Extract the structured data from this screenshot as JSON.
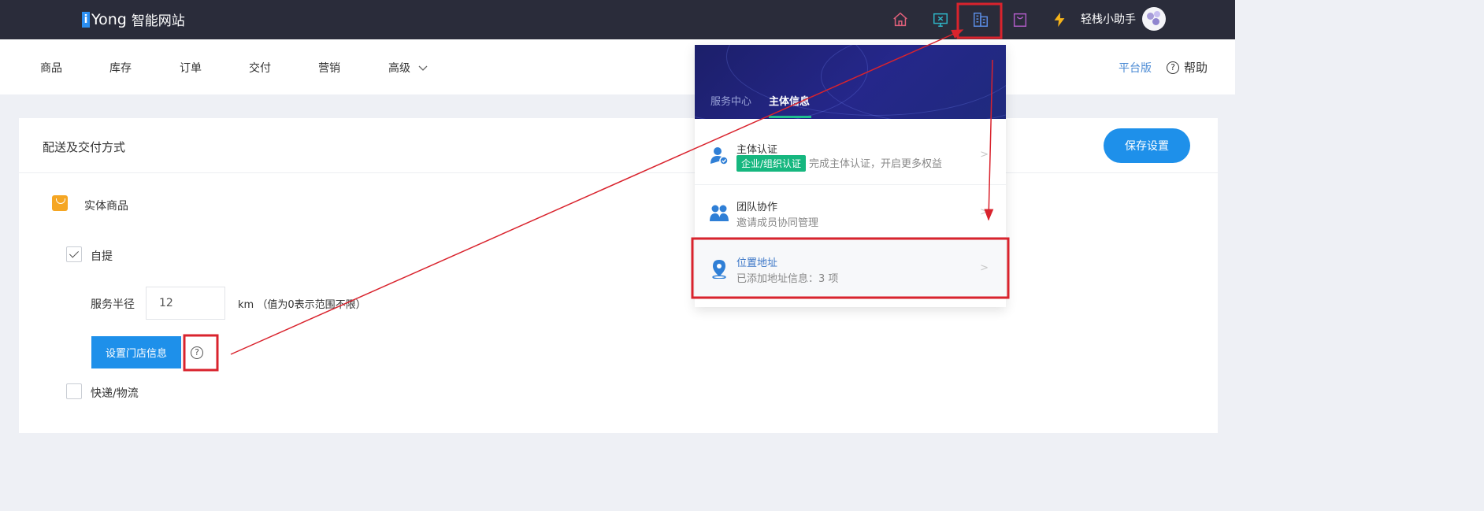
{
  "topbar": {
    "logo_mark": "i",
    "logo_brand": "Yong",
    "logo_cn": "智能网站",
    "icons": [
      "home-icon",
      "monitor-icon",
      "building-icon",
      "bag-icon",
      "lightning-icon"
    ],
    "user_name": "轻栈小助手"
  },
  "subnav": {
    "items": [
      "商品",
      "库存",
      "订单",
      "交付",
      "营销",
      "高级"
    ],
    "platform": "平台版",
    "help": "帮助"
  },
  "card": {
    "title": "配送及交付方式",
    "save_button": "保存设置",
    "section_label": "实体商品",
    "pickup_label": "自提",
    "pickup_checked": true,
    "radius_label": "服务半径",
    "radius_value": "12",
    "unit_text": "km （值为0表示范围不限）",
    "store_button": "设置门店信息",
    "delivery_label": "快递/物流",
    "delivery_checked": false
  },
  "panel": {
    "tab_service": "服务中心",
    "tab_entity": "主体信息",
    "rows": [
      {
        "title": "主体认证",
        "badge": "企业/组织认证",
        "sub": "完成主体认证，开启更多权益",
        "chev": ">"
      },
      {
        "title": "团队协作",
        "sub": "邀请成员协同管理",
        "chev": ">"
      },
      {
        "title": "位置地址",
        "sub": "已添加地址信息：3 项",
        "chev": ">"
      }
    ]
  },
  "colors": {
    "topbar_bg": "#2a2c3a",
    "primary_blue": "#1e90ea",
    "annotation_red": "#d9232d",
    "badge_green": "#16b77f",
    "panel_header": "#1c1f6a"
  }
}
